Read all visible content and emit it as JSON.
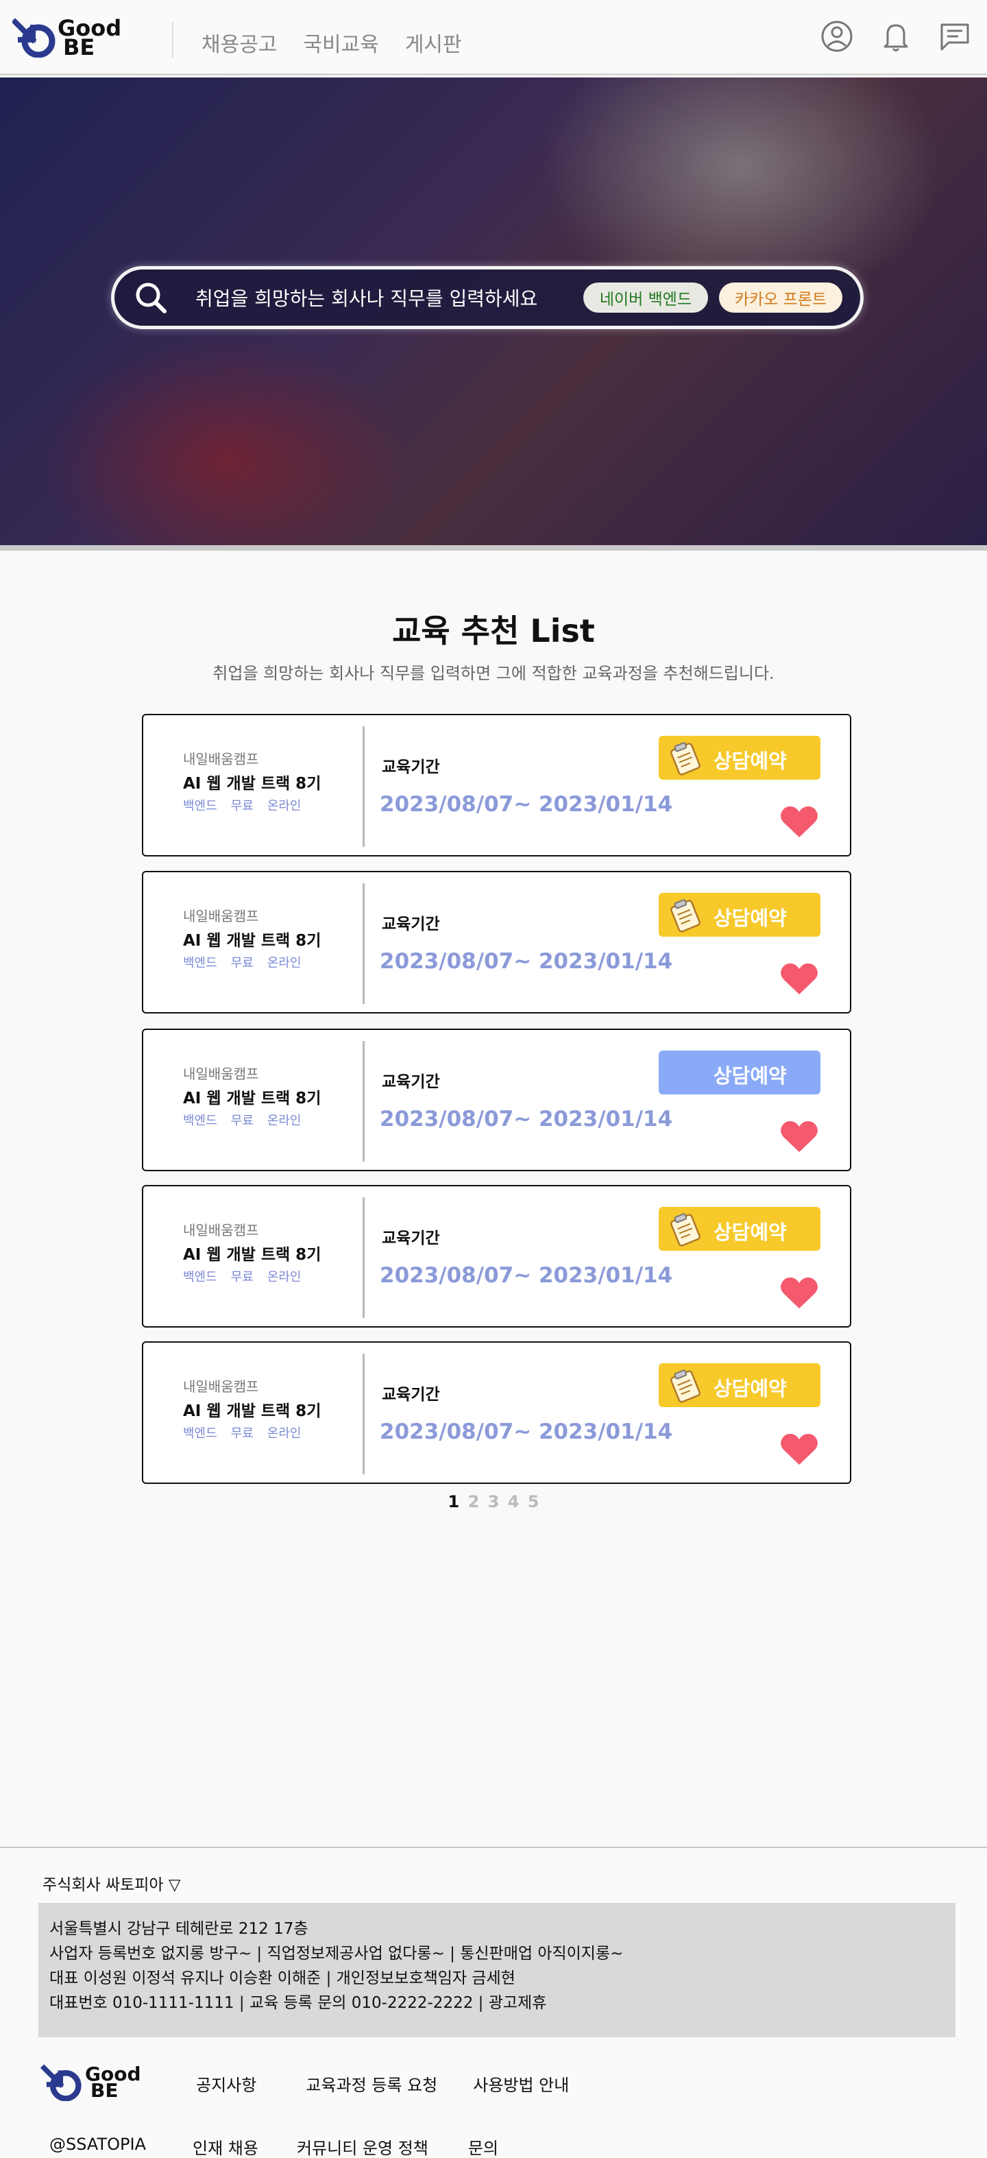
{
  "header": {
    "logo": {
      "line1": "Good",
      "line2": "BE"
    },
    "nav": [
      "채용공고",
      "국비교육",
      "게시판"
    ],
    "icons": [
      "user-icon",
      "bell-icon",
      "message-icon"
    ]
  },
  "hero": {
    "search_placeholder": "취업을 희망하는 회사나 직무를 입력하세요",
    "tags": [
      {
        "label": "네이버 백엔드",
        "color": "#1f7a1f"
      },
      {
        "label": "카카오 프론트",
        "color": "#d2781a"
      }
    ]
  },
  "section": {
    "title": "교육 추천 List",
    "subtitle": "취업을 희망하는 회사나 직무를 입력하면 그에 적합한 교육과정을 추천해드립니다."
  },
  "cards": [
    {
      "org": "내일배움캠프",
      "title": "AI 웹 개발 트랙 8기",
      "tags": [
        "백엔드",
        "무료",
        "온라인"
      ],
      "period_label": "교육기간",
      "period": "2023/08/07~ 2023/01/14",
      "button": "상담예약",
      "button_style": "yellow",
      "liked": true
    },
    {
      "org": "내일배움캠프",
      "title": "AI 웹 개발 트랙 8기",
      "tags": [
        "백엔드",
        "무료",
        "온라인"
      ],
      "period_label": "교육기간",
      "period": "2023/08/07~ 2023/01/14",
      "button": "상담예약",
      "button_style": "yellow",
      "liked": true
    },
    {
      "org": "내일배움캠프",
      "title": "AI 웹 개발 트랙 8기",
      "tags": [
        "백엔드",
        "무료",
        "온라인"
      ],
      "period_label": "교육기간",
      "period": "2023/08/07~ 2023/01/14",
      "button": "상담예약",
      "button_style": "blue",
      "liked": true
    },
    {
      "org": "내일배움캠프",
      "title": "AI 웹 개발 트랙 8기",
      "tags": [
        "백엔드",
        "무료",
        "온라인"
      ],
      "period_label": "교육기간",
      "period": "2023/08/07~ 2023/01/14",
      "button": "상담예약",
      "button_style": "yellow",
      "liked": true
    },
    {
      "org": "내일배움캠프",
      "title": "AI 웹 개발 트랙 8기",
      "tags": [
        "백엔드",
        "무료",
        "온라인"
      ],
      "period_label": "교육기간",
      "period": "2023/08/07~ 2023/01/14",
      "button": "상담예약",
      "button_style": "yellow",
      "liked": true
    }
  ],
  "pagination": {
    "pages": [
      "1",
      "2",
      "3",
      "4",
      "5"
    ],
    "current": "1"
  },
  "footer": {
    "company": "주식회사 싸토피아 ▽",
    "info": [
      "서울특별시 강남구 테헤란로 212 17층",
      "사업자 등록번호 없지롱 방구~ | 직업정보제공사업 없다롱~ | 통신판매업 아직이지롱~",
      "대표 이성원 이정석 유지나 이승환 이해준 | 개인정보보호책임자 금세현",
      "대표번호 010-1111-1111 | 교육 등록 문의 010-2222-2222 | 광고제휴"
    ],
    "logo": {
      "line1": "Good",
      "line2": "BE"
    },
    "links_row1": [
      "공지사항",
      "교육과정 등록 요청",
      "사용방법 안내"
    ],
    "handle": "@SSATOPIA",
    "links_row2": [
      "인재 채용",
      "커뮤니티 운영 정책",
      "문의"
    ]
  }
}
